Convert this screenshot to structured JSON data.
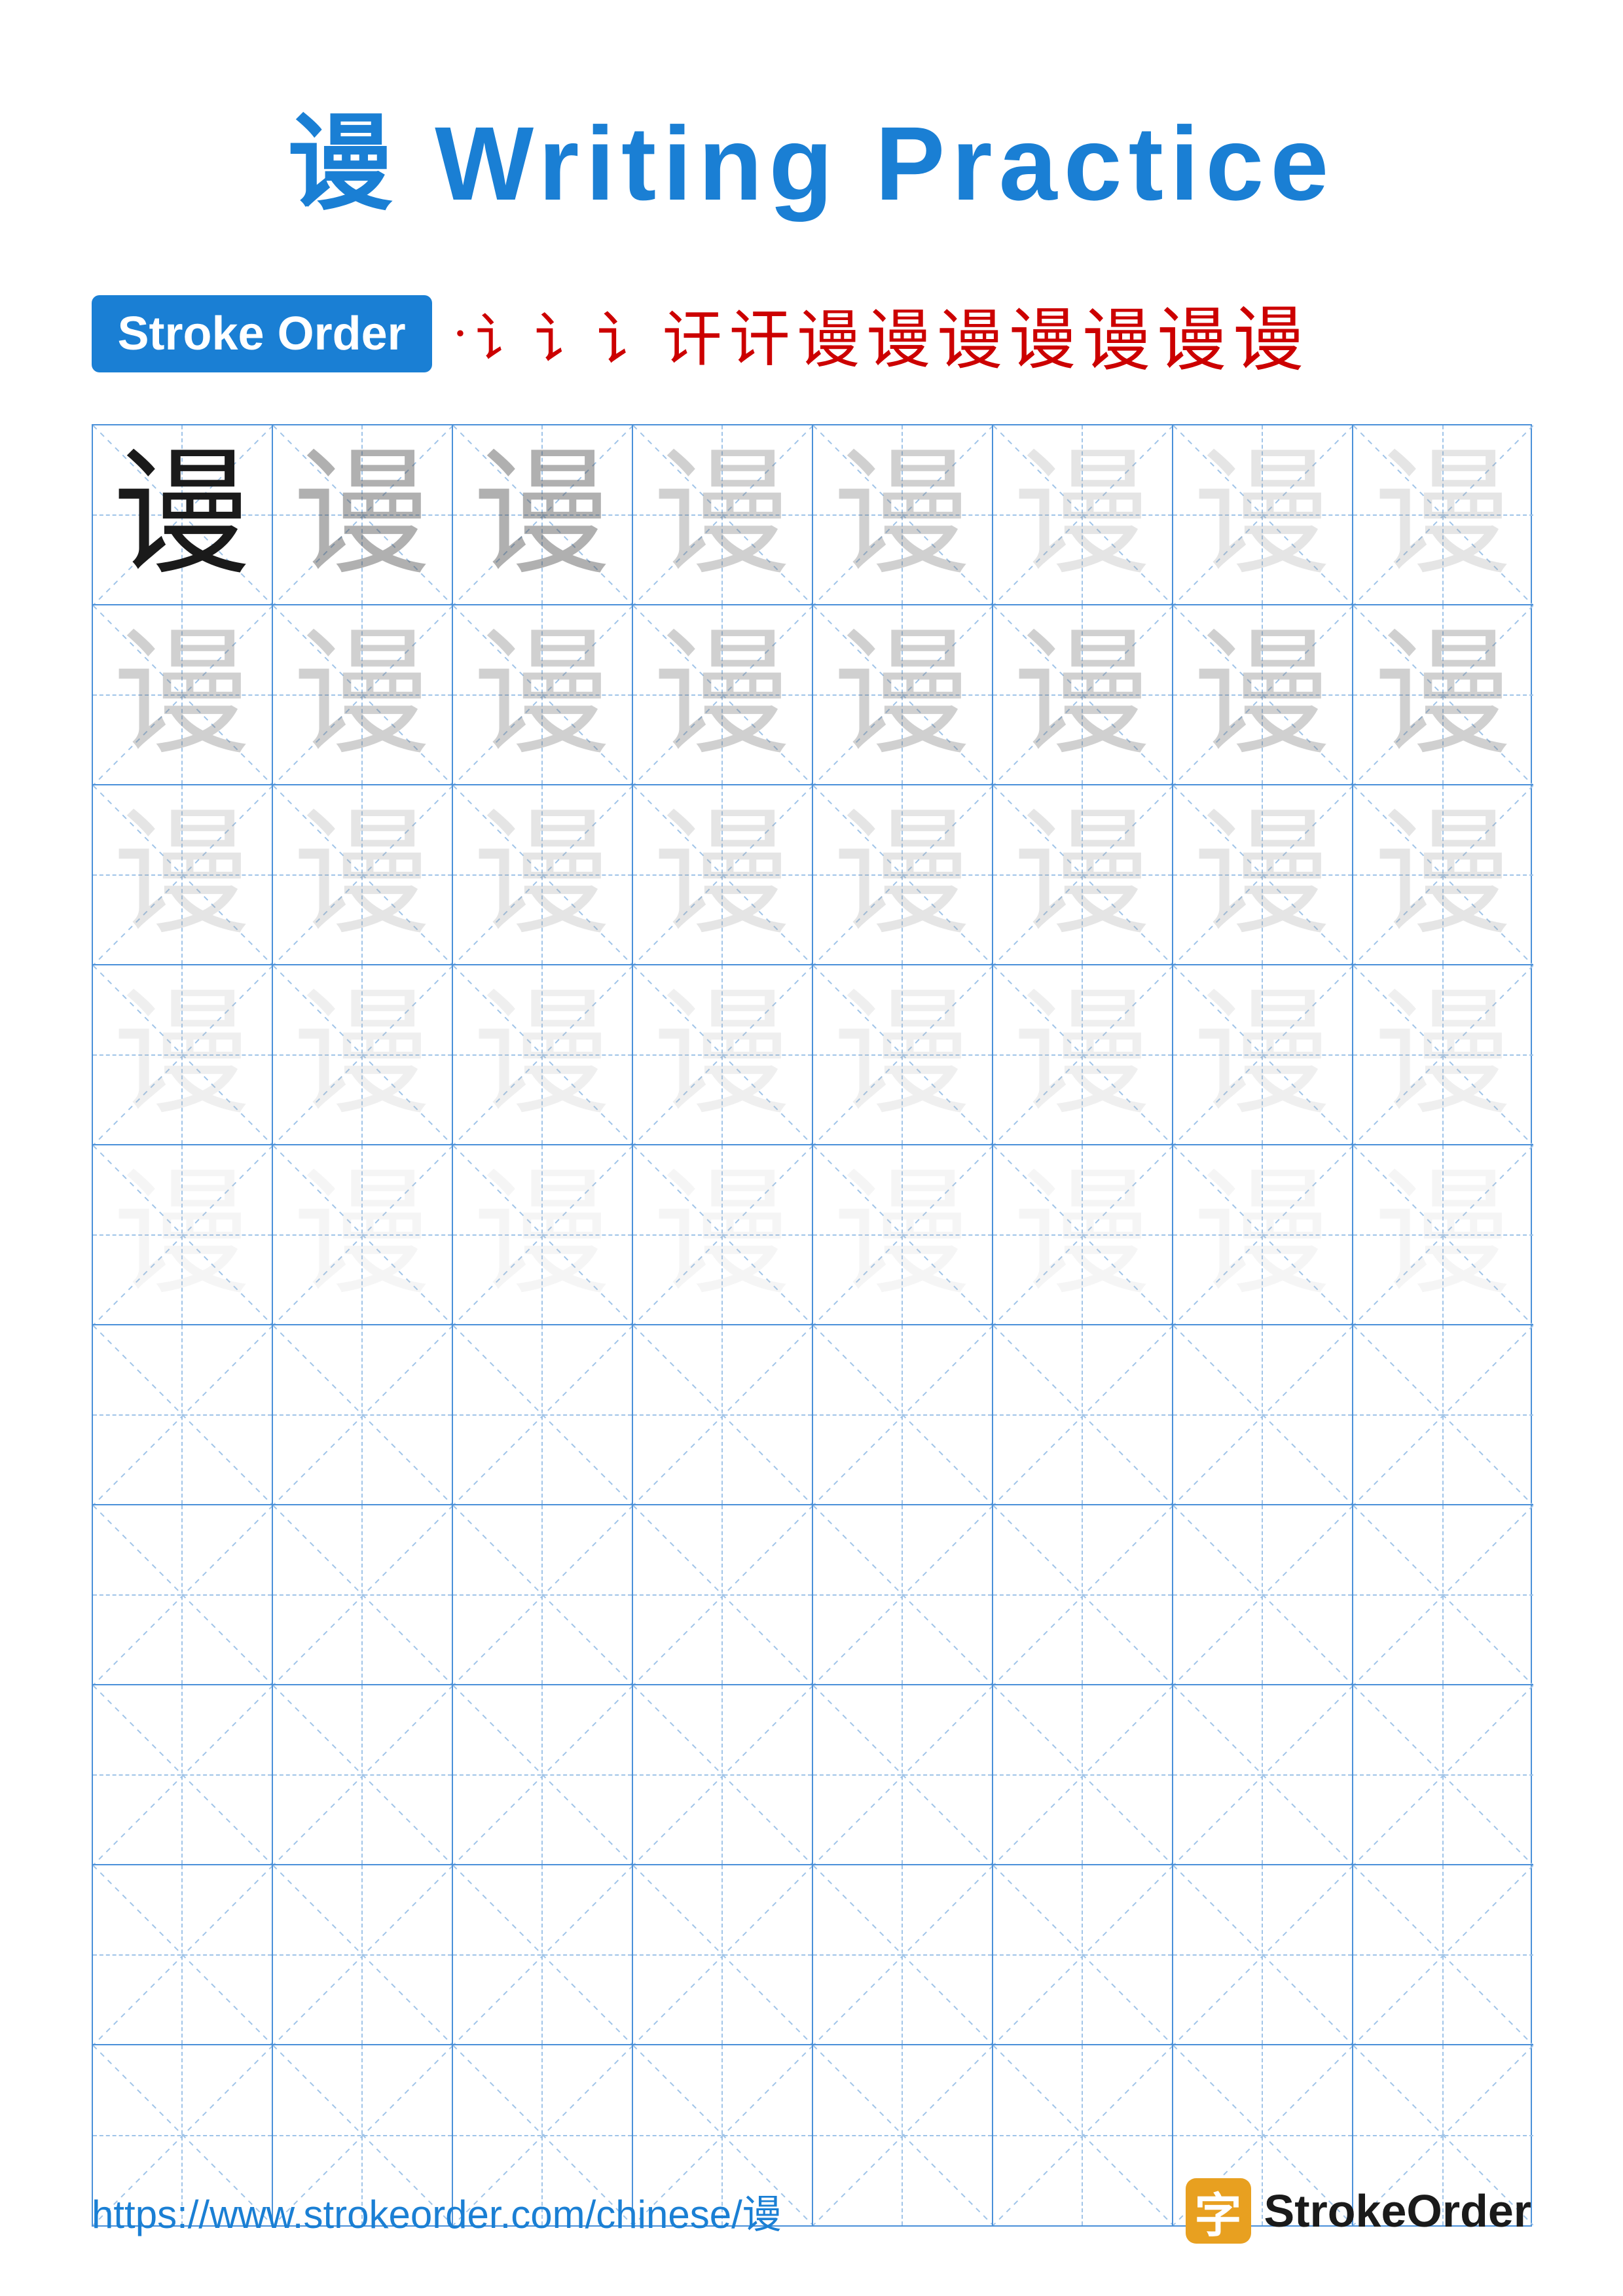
{
  "title": {
    "char": "谩",
    "text": "Writing Practice",
    "full": "谩 Writing Practice"
  },
  "stroke_order": {
    "badge_label": "Stroke Order",
    "chars": [
      "·",
      "i",
      "i·",
      "i⁻",
      "讠⁻",
      "讠⁻",
      "讠⁻⁻",
      "讠⁻⁻",
      "讦⁻",
      "谩⁻",
      "谩"
    ]
  },
  "grid": {
    "rows": 10,
    "cols": 8,
    "char": "谩"
  },
  "footer": {
    "url": "https://www.strokeorder.com/chinese/谩",
    "brand_char": "字",
    "brand_name": "StrokeOrder"
  }
}
